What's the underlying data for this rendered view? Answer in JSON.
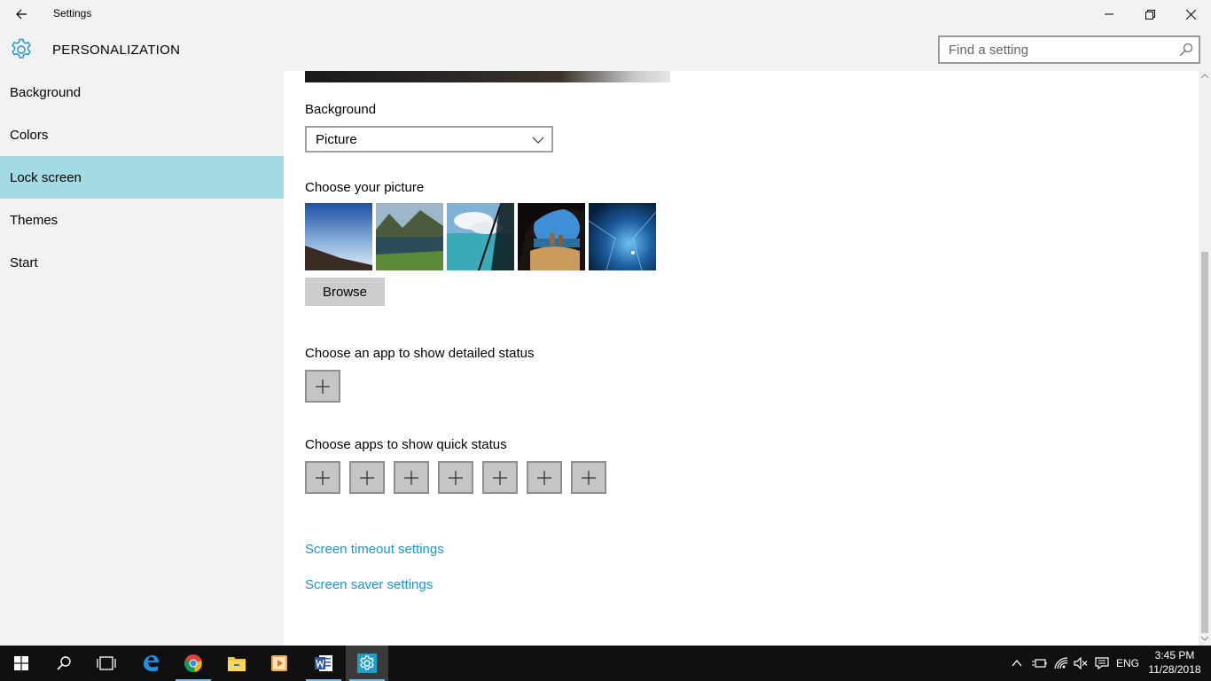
{
  "window": {
    "title": "Settings"
  },
  "header": {
    "section_title": "PERSONALIZATION",
    "search_placeholder": "Find a setting"
  },
  "sidebar": {
    "items": [
      {
        "label": "Background"
      },
      {
        "label": "Colors"
      },
      {
        "label": "Lock screen",
        "active": true
      },
      {
        "label": "Themes"
      },
      {
        "label": "Start"
      }
    ]
  },
  "main": {
    "background_label": "Background",
    "background_value": "Picture",
    "choose_picture_label": "Choose your picture",
    "browse_label": "Browse",
    "detailed_status_label": "Choose an app to show detailed status",
    "quick_status_label": "Choose apps to show quick status",
    "screen_timeout_link": "Screen timeout settings",
    "screen_saver_link": "Screen saver settings"
  },
  "taskbar": {
    "apps": [
      "start-icon",
      "search-icon",
      "task-view-icon",
      "edge-icon",
      "chrome-icon",
      "file-explorer-icon",
      "media-player-icon",
      "word-icon",
      "settings-icon"
    ],
    "language": "ENG",
    "time": "3:45 PM",
    "date": "11/28/2018"
  },
  "colors": {
    "accent": "#1a96c4",
    "selected_nav": "#a2dbe3",
    "taskbar": "#101010"
  }
}
